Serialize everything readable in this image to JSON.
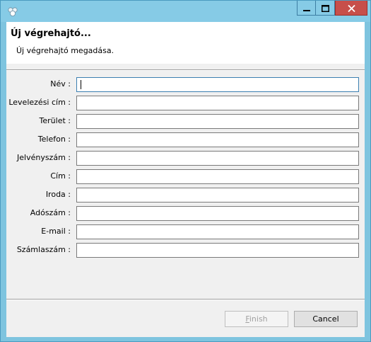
{
  "window": {
    "app_icon": "app-icon",
    "controls": [
      "minimize-icon",
      "maximize-icon",
      "close-icon"
    ]
  },
  "banner": {
    "title": "Új végrehajtó...",
    "description": "Új végrehajtó megadása."
  },
  "fields": [
    {
      "label": "Név :",
      "value": ""
    },
    {
      "label": "Levelezési cím :",
      "value": ""
    },
    {
      "label": "Terület :",
      "value": ""
    },
    {
      "label": "Telefon :",
      "value": ""
    },
    {
      "label": "Jelvényszám :",
      "value": ""
    },
    {
      "label": "Cím :",
      "value": ""
    },
    {
      "label": "Iroda :",
      "value": ""
    },
    {
      "label": "Adószám :",
      "value": ""
    },
    {
      "label": "E-mail :",
      "value": ""
    },
    {
      "label": "Számlaszám :",
      "value": ""
    }
  ],
  "buttons": {
    "finish_mnemonic": "F",
    "finish_rest": "inish",
    "cancel": "Cancel"
  }
}
